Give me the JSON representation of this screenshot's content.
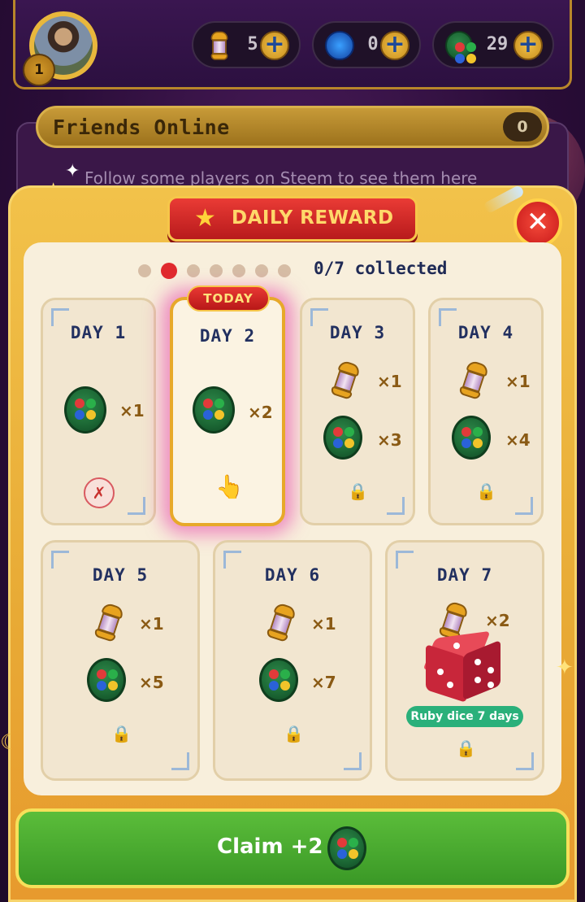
{
  "topbar": {
    "level": "1",
    "resources": [
      {
        "name": "lantern",
        "icon": "lantern-icon",
        "value": "5"
      },
      {
        "name": "steem",
        "icon": "steem-icon",
        "value": "0"
      },
      {
        "name": "coin",
        "icon": "coin-icon",
        "value": "29"
      }
    ],
    "plus_label": "+"
  },
  "friends": {
    "title": "Friends Online",
    "count": "0",
    "hint": "Follow some players on Steem to see them here"
  },
  "modal": {
    "title": "DAILY REWARD",
    "close_label": "✕",
    "collected": "0/7 collected",
    "total_days": 7,
    "current_day": 2,
    "today_badge": "TODAY",
    "days": [
      {
        "label": "DAY 1",
        "status": "missed",
        "rewards": [
          {
            "item": "coin",
            "qty": "×1"
          }
        ],
        "status_icon": "✗"
      },
      {
        "label": "DAY 2",
        "status": "today",
        "rewards": [
          {
            "item": "coin",
            "qty": "×2"
          }
        ],
        "status_icon": "👆"
      },
      {
        "label": "DAY 3",
        "status": "locked",
        "rewards": [
          {
            "item": "lantern",
            "qty": "×1"
          },
          {
            "item": "coin",
            "qty": "×3"
          }
        ],
        "status_icon": "🔒"
      },
      {
        "label": "DAY 4",
        "status": "locked",
        "rewards": [
          {
            "item": "lantern",
            "qty": "×1"
          },
          {
            "item": "coin",
            "qty": "×4"
          }
        ],
        "status_icon": "🔒"
      },
      {
        "label": "DAY 5",
        "status": "locked",
        "rewards": [
          {
            "item": "lantern",
            "qty": "×1"
          },
          {
            "item": "coin",
            "qty": "×5"
          }
        ],
        "status_icon": "🔒"
      },
      {
        "label": "DAY 6",
        "status": "locked",
        "rewards": [
          {
            "item": "lantern",
            "qty": "×1"
          },
          {
            "item": "coin",
            "qty": "×7"
          }
        ],
        "status_icon": "🔒"
      },
      {
        "label": "DAY 7",
        "status": "locked",
        "rewards": [
          {
            "item": "lantern",
            "qty": "×2"
          },
          {
            "item": "ruby-dice",
            "qty": "Ruby dice 7 days"
          }
        ],
        "status_icon": "🔒"
      }
    ],
    "claim_label": "Claim  +2"
  },
  "colors": {
    "accent_gold": "#f2c24a",
    "banner_red": "#e02a2e",
    "claim_green": "#4aa830",
    "text_navy": "#223060"
  }
}
